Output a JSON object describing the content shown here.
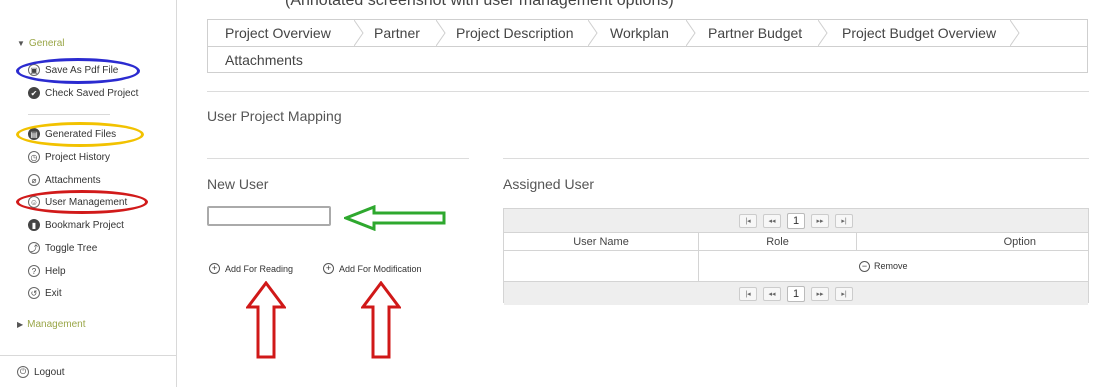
{
  "top_note": "(Annotated screenshot with user management options)",
  "sidebar": {
    "general_label": "General",
    "general_items": [
      {
        "label": "Save As Pdf File",
        "icon": "lock-icon"
      },
      {
        "label": "Check Saved Project",
        "icon": "check-icon"
      }
    ],
    "tool_items": [
      {
        "label": "Generated Files",
        "icon": "file-icon"
      },
      {
        "label": "Project History",
        "icon": "history-icon"
      },
      {
        "label": "Attachments",
        "icon": "paperclip-icon"
      },
      {
        "label": "User Management",
        "icon": "user-icon"
      },
      {
        "label": "Bookmark Project",
        "icon": "bookmark-icon"
      },
      {
        "label": "Toggle Tree",
        "icon": "tree-icon"
      },
      {
        "label": "Help",
        "icon": "help-icon"
      },
      {
        "label": "Exit",
        "icon": "exit-icon"
      }
    ],
    "management_label": "Management",
    "logout_label": "Logout"
  },
  "tabs": [
    "Project Overview",
    "Partner",
    "Project Description",
    "Workplan",
    "Partner Budget",
    "Project Budget Overview",
    "Attachments"
  ],
  "section_title": "User Project Mapping",
  "new_user": {
    "title": "New User",
    "input_value": "",
    "add_reading": "Add For Reading",
    "add_modification": "Add For Modification"
  },
  "assigned": {
    "title": "Assigned User",
    "columns": [
      "User Name",
      "Role",
      "Option"
    ],
    "rows": [
      {
        "user": "",
        "role": "",
        "option": "Remove"
      }
    ],
    "pager": {
      "first": "|◂",
      "prev": "◂◂",
      "page": "1",
      "next": "▸▸",
      "last": "▸|"
    }
  },
  "annotation_colors": {
    "blue": "#2b2bd0",
    "yellow": "#f2c200",
    "red_ellipse": "#d11a1a",
    "green_arrow": "#2ea82e",
    "red_arrow": "#d01818"
  }
}
